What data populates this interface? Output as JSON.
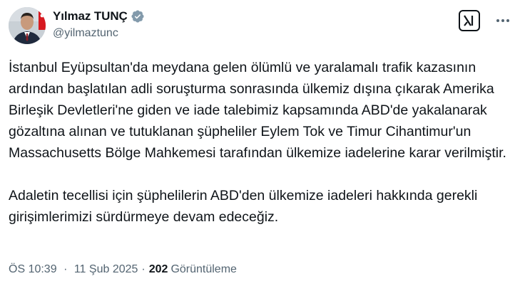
{
  "author": {
    "display_name": "Yılmaz TUNÇ",
    "handle": "@yilmaztunc",
    "verified_icon": "verified-badge-gray"
  },
  "actions": {
    "grok_icon": "grok-icon",
    "more_icon": "more-horizontal-icon"
  },
  "tweet": {
    "paragraphs": [
      "İstanbul Eyüpsultan'da meydana gelen ölümlü ve yaralamalı trafik kazasının ardından başlatılan adli soruşturma sonrasında ülkemiz dışına çıkarak Amerika Birleşik Devletleri'ne giden ve iade talebimiz kapsamında ABD'de yakalanarak gözaltına alınan ve tutuklanan şüpheliler Eylem Tok ve Timur Cihantimur'un Massachusetts Bölge Mahkemesi tarafından ülkemize iadelerine karar verilmiştir.",
      "Adaletin tecellisi için şüphelilerin ABD'den ülkemize iadeleri hakkında gerekli girişimlerimizi sürdürmeye devam edeceğiz."
    ]
  },
  "meta": {
    "time": "ÖS 10:39",
    "separator": "·",
    "date": "11 Şub 2025",
    "views_count": "202",
    "views_label": "Görüntüleme"
  },
  "colors": {
    "text_primary": "#0f1419",
    "text_secondary": "#536471",
    "verified_badge": "#829aab",
    "background": "#ffffff"
  }
}
